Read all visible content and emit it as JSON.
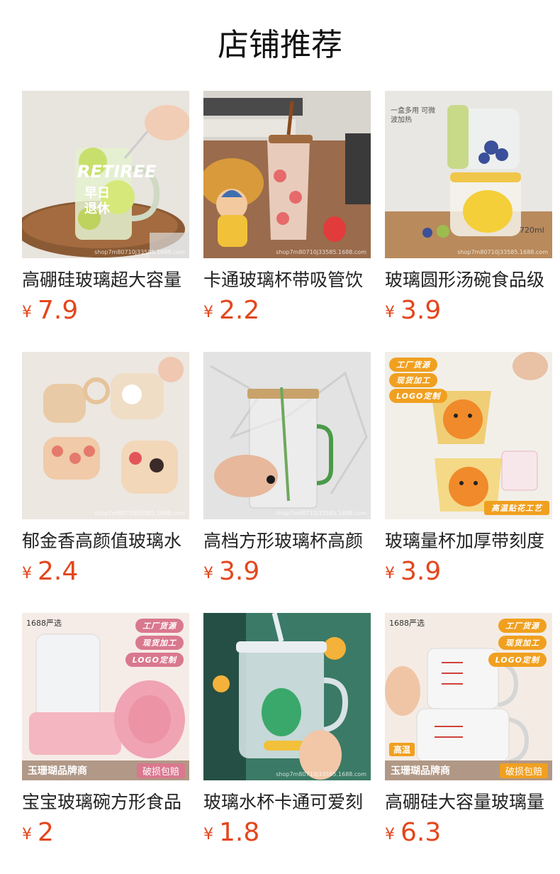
{
  "section_title": "店铺推荐",
  "currency_symbol": "¥",
  "watermark": "shop7m80710j33585.1688.com",
  "products": [
    {
      "name": "高硼硅玻璃超大容量",
      "price": "7.9",
      "image_text": "RETIREE",
      "image_text2": "早日",
      "image_text3": "退休"
    },
    {
      "name": "卡通玻璃杯带吸管饮",
      "price": "2.2"
    },
    {
      "name": "玻璃圆形汤碗食品级",
      "price": "3.9",
      "image_label": "一盒多用 可微波加热",
      "image_capacity": "720ml"
    },
    {
      "name": "郁金香高颜值玻璃水",
      "price": "2.4"
    },
    {
      "name": "高档方形玻璃杯高颜",
      "price": "3.9"
    },
    {
      "name": "玻璃量杯加厚带刻度",
      "price": "3.9",
      "tags": [
        "工厂货源",
        "现货加工",
        "LOGO定制"
      ],
      "bottom_tag": "高温贴花工艺"
    },
    {
      "name": "宝宝玻璃碗方形食品",
      "price": "2",
      "top_badge": "1688严选",
      "tags": [
        "工厂货源",
        "现货加工",
        "LOGO定制"
      ],
      "brand": "玉珊瑚品牌商",
      "guarantee": "破损包赔"
    },
    {
      "name": "玻璃水杯卡通可爱刻",
      "price": "1.8"
    },
    {
      "name": "高硼硅大容量玻璃量",
      "price": "6.3",
      "top_badge": "1688严选",
      "tags": [
        "工厂货源",
        "现货加工",
        "LOGO定制"
      ],
      "corner_tag": "高温",
      "brand": "玉珊瑚品牌商",
      "guarantee": "破损包赔"
    }
  ],
  "colors": {
    "price": "#e3461c",
    "tag_orange": "#f0a020",
    "tag_pink": "#d9788e"
  }
}
